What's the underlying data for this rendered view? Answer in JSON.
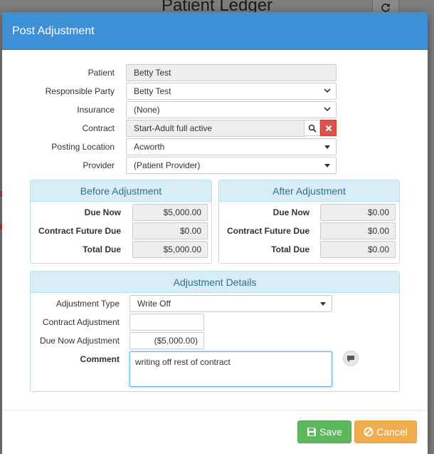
{
  "background": {
    "page_title": "Patient Ledger",
    "refresh_icon": "refresh-icon"
  },
  "modal": {
    "title": "Post Adjustment"
  },
  "form": {
    "patient": {
      "label": "Patient",
      "value": "Betty Test"
    },
    "responsible_party": {
      "label": "Responsible Party",
      "value": "Betty Test"
    },
    "insurance": {
      "label": "Insurance",
      "value": "(None)"
    },
    "contract": {
      "label": "Contract",
      "value": "Start-Adult full active"
    },
    "posting_location": {
      "label": "Posting Location",
      "value": "Acworth"
    },
    "provider": {
      "label": "Provider",
      "value": "(Patient Provider)"
    }
  },
  "before_adjustment": {
    "title": "Before Adjustment",
    "due_now": {
      "label": "Due Now",
      "value": "$5,000.00"
    },
    "contract_future_due": {
      "label": "Contract Future Due",
      "value": "$0.00"
    },
    "total_due": {
      "label": "Total Due",
      "value": "$5,000.00"
    }
  },
  "after_adjustment": {
    "title": "After Adjustment",
    "due_now": {
      "label": "Due Now",
      "value": "$0.00"
    },
    "contract_future_due": {
      "label": "Contract Future Due",
      "value": "$0.00"
    },
    "total_due": {
      "label": "Total Due",
      "value": "$0.00"
    }
  },
  "adjustment_details": {
    "title": "Adjustment Details",
    "adjustment_type": {
      "label": "Adjustment Type",
      "value": "Write Off"
    },
    "contract_adjustment": {
      "label": "Contract Adjustment",
      "value": ""
    },
    "due_now_adjustment": {
      "label": "Due Now Adjustment",
      "value": "($5,000.00)"
    },
    "comment": {
      "label": "Comment",
      "value": "writing off rest of contract"
    }
  },
  "footer": {
    "save_label": "Save",
    "cancel_label": "Cancel"
  },
  "colors": {
    "header_blue": "#3d8fd6",
    "panel_head_bg": "#d9edf7",
    "save_green": "#5cb85c",
    "cancel_orange": "#f0ad4e",
    "clear_red": "#d9534f"
  }
}
